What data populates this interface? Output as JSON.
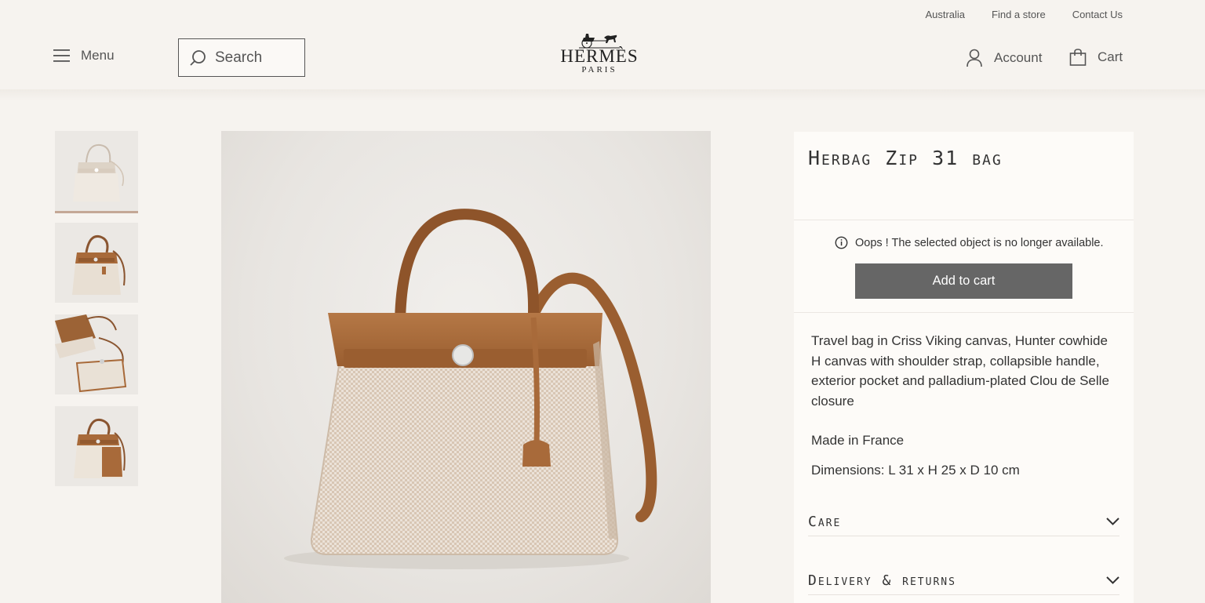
{
  "utility": {
    "country": "Australia",
    "find_store": "Find a store",
    "contact": "Contact Us"
  },
  "header": {
    "menu_label": "Menu",
    "search_placeholder": "Search",
    "logo_word": "HERMÈS",
    "logo_sub": "PARIS",
    "account_label": "Account",
    "cart_label": "Cart"
  },
  "thumbnails": [
    {
      "alt": "Front view",
      "active": true
    },
    {
      "alt": "Three-quarter view"
    },
    {
      "alt": "Open with pouch"
    },
    {
      "alt": "Side view"
    }
  ],
  "product": {
    "title": "Herbag Zip 31 bag",
    "availability_msg": "Oops ! The selected object is no longer available.",
    "add_to_cart": "Add to cart",
    "description": "Travel bag in Criss Viking canvas, Hunter cowhide H canvas with shoulder strap, collapsible handle, exterior pocket and palladium-plated Clou de Selle closure",
    "made_in": "Made in France",
    "dimensions": "Dimensions: L 31 x H 25 x D 10 cm"
  },
  "accordion": [
    {
      "title": "Care"
    },
    {
      "title": "Delivery & returns"
    }
  ],
  "colors": {
    "background": "#f6f3ef",
    "panel": "#fdfbf8",
    "button": "#666666",
    "leather": "#a86a3a",
    "canvas": "#e7ddd1"
  }
}
